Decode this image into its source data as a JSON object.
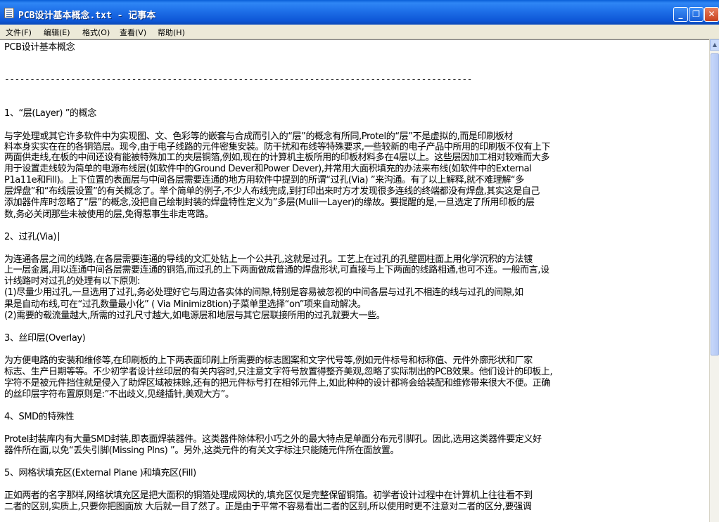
{
  "window": {
    "title": "PCB设计基本概念.txt - 记事本",
    "buttons": {
      "minimize": "_",
      "maximize": "❐",
      "close": "✕"
    },
    "icon": "notepad-icon"
  },
  "menu": [
    {
      "label": "文件(F)"
    },
    {
      "label": "编辑(E)"
    },
    {
      "label": "格式(O)"
    },
    {
      "label": "查看(V)"
    },
    {
      "label": "帮助(H)"
    }
  ],
  "document": {
    "lines": [
      "PCB设计基本概念",
      "--------------------------------------------------------------------------------------------",
      "1、“层(Layer) ”的概念",
      "      与字处理或其它许多软件中为实现图、文、色彩等的嵌套与合成而引入的“层”的概念有所同,Protel的“层”不是虚拟的,而是印刷板材",
      "料本身实实在在的各铜箔层。现今,由于电子线路的元件密集安装。防干扰和布线等特殊要求,一些较新的电子产品中所用的印刷板不仅有上下",
      "两面供走线,在板的中间还设有能被特殊加工的夹层铜箔,例如,现在的计算机主板所用的印板材料多在4层以上。这些层因加工相对较难而大多",
      "用于设置走线较为简单的电源布线层(如软件中的Ground Dever和Power Dever),并常用大面积填充的办法来布线(如软件中的External",
      "P1a11e和Fill)。上下位置的表面层与中间各层需要连通的地方用软件中提到的所谓“过孔(Via) ”来沟通。有了以上解释,就不难理解“多",
      "层焊盘”和“布线层设置”的有关概念了。举个简单的例子,不少人布线完成,到打印出来时方才发现很多连线的终端都没有焊盘,其实这是自己",
      "添加器件库时忽略了“层”的概念,没把自己绘制封装的焊盘特性定义为”多层(Mulii一Layer)的缘故。要提醒的是,一旦选定了所用印板的层",
      "数,务必关闭那些未被使用的层,免得惹事生非走弯路。",
      "      2、过孔(Via)",
      "      为连通各层之间的线路,在各层需要连通的导线的文汇处钻上一个公共孔,这就是过孔。工艺上在过孔的孔壁圆柱面上用化学沉积的方法镀",
      "上一层金属,用以连通中间各层需要连通的铜箔,而过孔的上下两面做成普通的焊盘形状,可直接与上下两面的线路相通,也可不连。一般而言,设",
      "计线路时对过孔的处理有以下原则:",
      "   (1)尽量少用过孔,一旦选用了过孔,务必处理好它与周边各实体的间隙,特别是容易被忽视的中间各层与过孔不相连的线与过孔的间隙,如",
      "果是自动布线,可在“过孔数量最小化” ( Via Minimiz8tion)子菜单里选择“on”项来自动解决。",
      "   (2)需要的载流量越大,所需的过孔尺寸越大,如电源层和地层与其它层联接所用的过孔就要大一些。",
      "      3、丝印层(Overlay)",
      "      为方便电路的安装和维修等,在印刷板的上下两表面印刷上所需要的标志图案和文字代号等,例如元件标号和标称值、元件外廓形状和厂家",
      "标志、生产日期等等。不少初学者设计丝印层的有关内容时,只注意文字符号放置得整齐美观,忽略了实际制出的PCB效果。他们设计的印板上,",
      "字符不是被元件挡住就是侵入了助焊区域被抹赊,还有的把元件标号打在相邻元件上,如此种种的设计都将会给装配和维修带来很大不便。正确",
      "的丝印层字符布置原则是:”不出歧义,见缝插针,美观大方”。",
      "      4、SMD的特殊性",
      "      Protel封装库内有大量SMD封装,即表面焊装器件。这类器件除体积小巧之外的最大特点是单面分布元引脚孔。因此,选用这类器件要定义好",
      "器件所在面,以免“丢失引脚(Missing Plns) ”。另外,这类元件的有关文字标注只能随元件所在面放置。",
      "      5、网格状填充区(External Plane )和填充区(Fill)",
      "      正如两者的名字那样,网络状填充区是把大面积的铜箔处理成网状的,填充区仅是完整保留铜箔。初学者设计过程中在计算机上往往看不到",
      "二者的区别,实质上,只要你把图面放      大后就一目了然了。正是由于平常不容易看出二者的区别,所以使用时更不注意对二者的区分,要强调"
    ]
  },
  "colors": {
    "titlebar": "#0d56d6",
    "menubar": "#ece9d8",
    "close_button": "#c8411d",
    "text": "#000000"
  }
}
